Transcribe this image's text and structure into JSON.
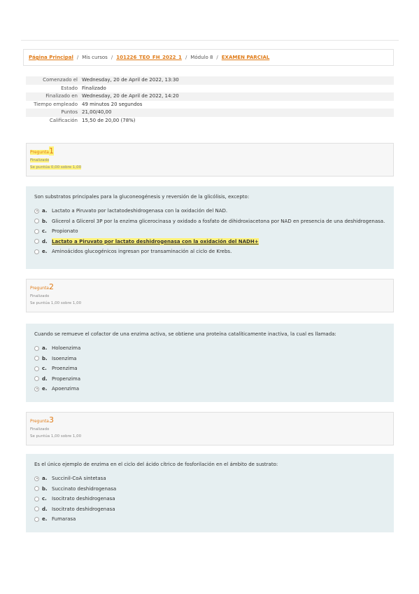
{
  "breadcrumb": {
    "home": "Página Principal",
    "courses": "Mis cursos",
    "course": "101226_TEO_FH_2022_1",
    "module": "Módulo 8",
    "exam": "EXAMEN PARCIAL",
    "separator": "/"
  },
  "summary": [
    {
      "key": "Comenzado el",
      "value": "Wednesday, 20 de April de 2022, 13:30"
    },
    {
      "key": "Estado",
      "value": "Finalizado"
    },
    {
      "key": "Finalizado en",
      "value": "Wednesday, 20 de April de 2022, 14:20"
    },
    {
      "key": "Tiempo empleado",
      "value": "49 minutos 20 segundos"
    },
    {
      "key": "Puntos",
      "value": "21,00/40,00"
    },
    {
      "key": "Calificación",
      "value": "15,50 de 20,00 (78%)"
    }
  ],
  "questions": [
    {
      "label": "Pregunta",
      "number": "1",
      "status": "Finalizado",
      "score": "Se puntúa 0,00 sobre 1,00",
      "text": "Son substratos principales para la gluconeogénesis y reversión de la glicólisis, excepto:",
      "options": [
        {
          "letter": "a.",
          "text": "Lactato a Piruvato por lactatodeshidrogenasa con la oxidación del NAD."
        },
        {
          "letter": "b.",
          "text": "Glicerol a Glicerol 3P por la enzima glicerocinasa y oxidado a fosfato de dihidroxiacetona por NAD en presencia de una deshidrogenasa."
        },
        {
          "letter": "c.",
          "text": "Propionato"
        },
        {
          "letter": "d.",
          "text": "Lactato a Piruvato por lactato deshidrogenasa con la oxidación del NADH+"
        },
        {
          "letter": "e.",
          "text": "Aminoácidos glucogénicos ingresan por transaminación al ciclo de Krebs."
        }
      ]
    },
    {
      "label": "Pregunta",
      "number": "2",
      "status": "Finalizado",
      "score": "Se puntúa 1,00 sobre 1,00",
      "text": "Cuando se remueve el cofactor de una enzima activa, se obtiene una proteína catalíticamente inactiva, la cual es llamada:",
      "options": [
        {
          "letter": "a.",
          "text": "Holoenzima"
        },
        {
          "letter": "b.",
          "text": "Isoenzima"
        },
        {
          "letter": "c.",
          "text": "Proenzima"
        },
        {
          "letter": "d.",
          "text": "Propenzima"
        },
        {
          "letter": "e.",
          "text": "Apoenzima"
        }
      ]
    },
    {
      "label": "Pregunta",
      "number": "3",
      "status": "Finalizado",
      "score": "Se puntúa 1,00 sobre 1,00",
      "text": "Es el único ejemplo de enzima en el ciclo del ácido cítrico de fosforilación en el ámbito de sustrato:",
      "options": [
        {
          "letter": "a.",
          "text": "Succinil-CoA sintetasa"
        },
        {
          "letter": "b.",
          "text": "Succinato deshidrogenasa"
        },
        {
          "letter": "c.",
          "text": "Isocitrato deshidrogenasa"
        },
        {
          "letter": "d.",
          "text": "Isocitrato deshidrogenasa"
        },
        {
          "letter": "e.",
          "text": "Fumarasa"
        }
      ]
    }
  ]
}
